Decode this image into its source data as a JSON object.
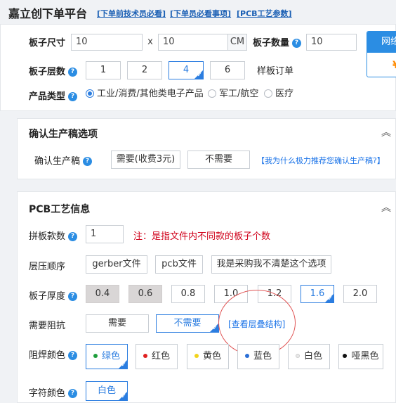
{
  "header": {
    "title": "嘉立创下单平台",
    "links": [
      "[下单前技术员必看]",
      "[下单员必看事项]",
      "[PCB工艺参数]"
    ]
  },
  "basic": {
    "board_size_label": "板子尺寸",
    "width_value": "10",
    "times": "x",
    "height_value": "10",
    "unit": "CM",
    "qty_label": "板子数量",
    "qty_value": "10",
    "layers_label": "板子层数",
    "layers": [
      "1",
      "2",
      "4",
      "6"
    ],
    "layers_selected": "4",
    "sample_order": "样板订单",
    "product_type_label": "产品类型",
    "product_types": [
      "工业/消费/其他类电子产品",
      "军工/航空",
      "医疗"
    ],
    "product_type_selected": "工业/消费/其他类电子产品"
  },
  "order_box": {
    "label": "网络",
    "currency": "¥"
  },
  "confirm": {
    "title": "确认生产稿选项",
    "row_label": "确认生产稿",
    "options": [
      "需要(收费3元)",
      "不需要"
    ],
    "link": "【我为什么极力推荐您确认生产稿?】"
  },
  "pcb": {
    "title": "PCB工艺信息",
    "panel_count_label": "拼板款数",
    "panel_count_value": "1",
    "panel_note": "注：是指文件内不同款的板子个数",
    "stack_order_label": "层压顺序",
    "stack_options": [
      "gerber文件",
      "pcb文件",
      "我是采购我不清楚这个选项"
    ],
    "thickness_label": "板子厚度",
    "thickness": [
      "0.4",
      "0.6",
      "0.8",
      "1.0",
      "1.2",
      "1.6",
      "2.0"
    ],
    "thickness_selected": "1.6",
    "impedance_label": "需要阻抗",
    "impedance": [
      "需要",
      "不需要"
    ],
    "impedance_selected": "不需要",
    "stack_link": "[查看层叠结构]",
    "mask_label": "阻焊颜色",
    "mask_colors": [
      {
        "name": "绿色",
        "dot": "#1e9e3c"
      },
      {
        "name": "红色",
        "dot": "#e02020"
      },
      {
        "name": "黄色",
        "dot": "#f2d31b"
      },
      {
        "name": "蓝色",
        "dot": "#2b6fd6"
      },
      {
        "name": "白色",
        "dot": "#e8e8e8"
      },
      {
        "name": "哑黑色",
        "dot": "#111111"
      }
    ],
    "mask_selected": "绿色",
    "silk_label": "字符颜色",
    "silk_value": "白色"
  }
}
